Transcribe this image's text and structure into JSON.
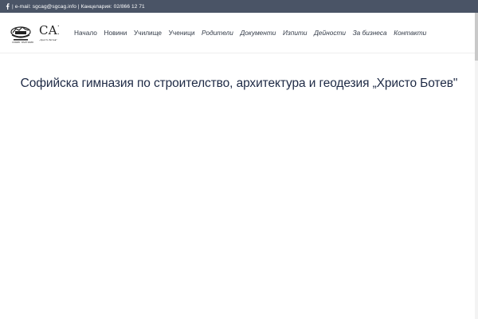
{
  "topbar": {
    "facebook_icon": "facebook-icon",
    "separator": "|",
    "contact_text": "e-mail: sgcag@sgcag.info | Канцелария: 02/866 12 71"
  },
  "logo": {
    "text": "САГ",
    "subtitle_left": "СОФИЯ · БЪЛГАРИЯ",
    "subtitle_right": "„Христо Ботев\""
  },
  "nav": {
    "items": [
      {
        "label": "Начало"
      },
      {
        "label": "Новини"
      },
      {
        "label": "Училище"
      },
      {
        "label": "Ученици"
      },
      {
        "label": "Родители"
      },
      {
        "label": "Документи"
      },
      {
        "label": "Изпити"
      },
      {
        "label": "Дейности"
      },
      {
        "label": "За бизнеса"
      },
      {
        "label": "Контакти"
      }
    ]
  },
  "main": {
    "title": "Софийска гимназия по строителство, архитектура и геодезия „Христо Ботев\""
  }
}
